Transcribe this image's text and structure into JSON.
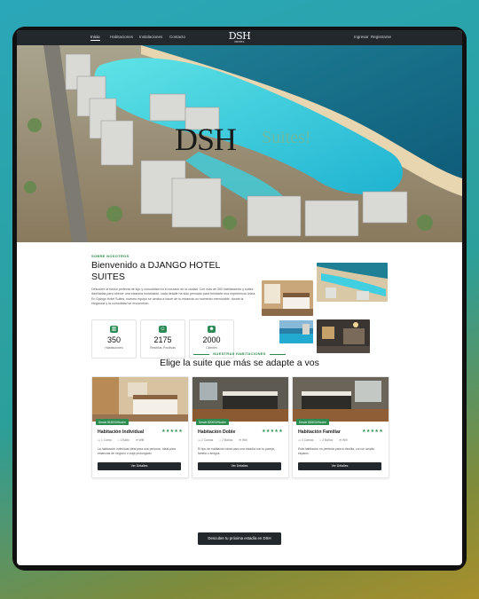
{
  "nav": {
    "links": [
      "Inicio",
      "Habitaciones",
      "Instalaciones",
      "Contacto"
    ],
    "logo_main": "DSH",
    "logo_sub": "HOTEL",
    "auth": [
      "Ingresar",
      "Registrarse"
    ]
  },
  "hero": {
    "title": "DSH",
    "subtitle": "Suites!"
  },
  "about": {
    "label": "SOBRE NOSOTROS",
    "title": "Bienvenido a DJANGO HOTEL SUITES",
    "text": "Descubre la fusión perfecta de lujo y comodidad en el corazón de la ciudad. Con más de 300 habitaciones y suites diseñadas para ofrecer una estancia inolvidable, cada detalle ha sido pensado para brindarte una experiencia única. En Django Hotel Suites, nuestro equipo se dedica a hacer de tu estancia un momento memorable, donde la elegancia y la comodidad se encuentran.",
    "stats": [
      {
        "icon": "building-icon",
        "value": "350",
        "label": "Habitaciones"
      },
      {
        "icon": "users-icon",
        "value": "2175",
        "label": "Reseñas Positivas"
      },
      {
        "icon": "group-icon",
        "value": "2000",
        "label": "Clientes"
      }
    ]
  },
  "rooms": {
    "label": "NUESTRAS HABITACIONES",
    "title": "Elige la suite que más se adapte a vos",
    "cards": [
      {
        "name": "Habitación Individual",
        "price": "Desde $15000/Noche",
        "stars": "★★★★★",
        "meta": [
          "1 Cama",
          "1 Baño",
          "Wifi"
        ],
        "desc": "La habitación individual ideal para una persona. Ideal para estancias de negocio o viaje prolongado.",
        "button": "Ver Detalles"
      },
      {
        "name": "Habitación Doble",
        "price": "Desde $20000/Noche",
        "stars": "★★★★★",
        "meta": [
          "2 Camas",
          "2 Baños",
          "Wifi"
        ],
        "desc": "El tipo de habitación ideal para una estadía con tu pareja, familia o amigos.",
        "button": "Ver Detalles"
      },
      {
        "name": "Habitación Familiar",
        "price": "Desde $30000/Noche",
        "stars": "★★★★★",
        "meta": [
          "4 Camas",
          "2 Baños",
          "Wifi"
        ],
        "desc": "Esta habitación es perfecta para tu familia, con un amplio espacio.",
        "button": "Ver Detalles"
      }
    ]
  },
  "cta": {
    "label": "Descubre tu próxima estadía en DSH"
  },
  "colors": {
    "accent": "#2a8c4f",
    "dark": "#23282d"
  }
}
